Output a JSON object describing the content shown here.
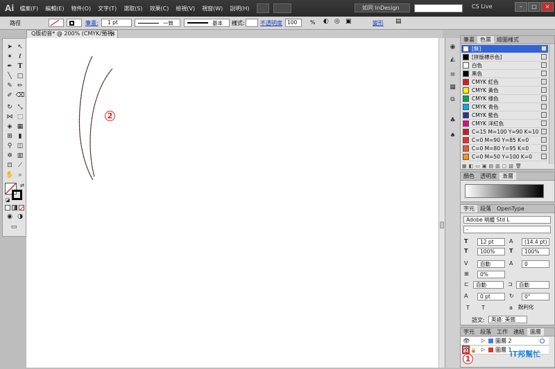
{
  "app": {
    "logo": "Ai"
  },
  "menu": [
    "檔案(F)",
    "編輯(E)",
    "物件(O)",
    "文字(T)",
    "選取(S)",
    "效果(C)",
    "檢視(V)",
    "視窗(W)",
    "說明(H)"
  ],
  "workspace": "如同 InDesign",
  "cs_live": "CS Live",
  "window_buttons": [
    "–",
    "□",
    "×"
  ],
  "control_bar": {
    "label": "路徑",
    "stroke_label": "筆畫:",
    "stroke_value": "1 pt",
    "profile_1": "一致",
    "profile_2": "基本",
    "style_label": "樣式:",
    "opacity_label": "不透明度",
    "opacity_value": "100",
    "opacity_unit": "%",
    "shape_label": "變形"
  },
  "document_tab": "Q版初音* @ 200% (CMYK/預視)",
  "annotations": {
    "a1": "1",
    "a2": "2"
  },
  "swatches": {
    "tabs": [
      "筆畫",
      "色票",
      "繪圖樣式"
    ],
    "items": [
      {
        "name": "[無]",
        "color": "#ffffff",
        "selected": true
      },
      {
        "name": "[拼版標示色]",
        "color": "#000000"
      },
      {
        "name": "白色",
        "color": "#ffffff"
      },
      {
        "name": "黑色",
        "color": "#000000"
      },
      {
        "name": "CMYK 紅色",
        "color": "#e3171d"
      },
      {
        "name": "CMYK 黃色",
        "color": "#fff100"
      },
      {
        "name": "CMYK 綠色",
        "color": "#00a650"
      },
      {
        "name": "CMYK 青色",
        "color": "#00aeef"
      },
      {
        "name": "CMYK 藍色",
        "color": "#2e3192"
      },
      {
        "name": "CMYK 洋紅色",
        "color": "#ec008c"
      },
      {
        "name": "C=15 M=100 Y=90 K=10",
        "color": "#be1e2d"
      },
      {
        "name": "C=0 M=90 Y=85 K=0",
        "color": "#ed2e2a"
      },
      {
        "name": "C=0 M=80 Y=95 K=0",
        "color": "#f05a28"
      },
      {
        "name": "C=0 M=50 Y=100 K=0",
        "color": "#f7941d"
      }
    ]
  },
  "gradient_panel": {
    "tabs": [
      "顏色",
      "透明度",
      "漸層"
    ]
  },
  "character": {
    "tabs": [
      "字元",
      "段落",
      "OpenType"
    ],
    "font": "Adobe 明體 Std L",
    "style": "-",
    "size": "12 pt",
    "leading": "(14.4 pt)",
    "vscale": "100%",
    "hscale": "100%",
    "kerning": "自動",
    "tracking": "0",
    "tsume": "0%",
    "aki_left": "自動",
    "aki_right": "自動",
    "baseline": "0 pt",
    "rotation": "0°",
    "aa_label": "銳利化",
    "language_label": "語文:",
    "language": "英語: 美國"
  },
  "layers": {
    "tabs": [
      "字元",
      "段落",
      "工作",
      "連結",
      "圖層"
    ],
    "items": [
      "圖層 2",
      "圖層 1"
    ]
  },
  "watermark": "iT邦幫忙"
}
